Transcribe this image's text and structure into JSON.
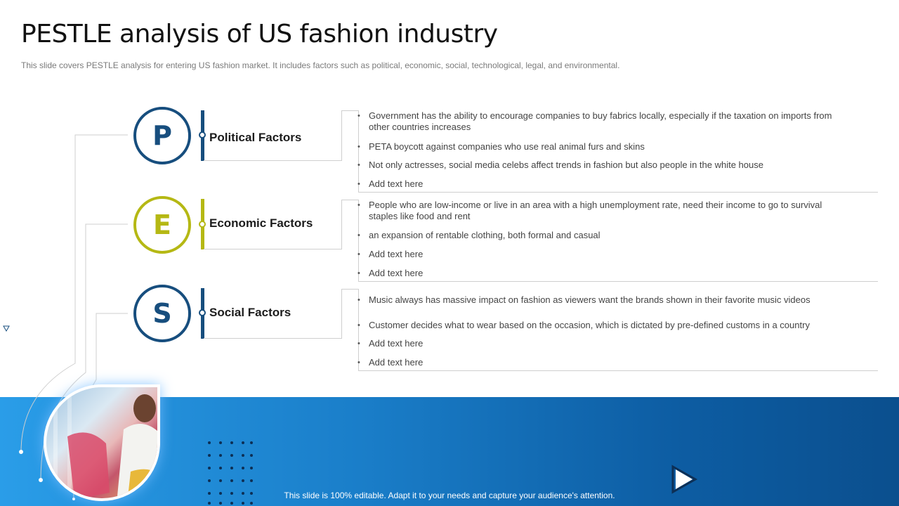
{
  "header": {
    "title": "PESTLE analysis of US fashion industry",
    "subtitle": "This slide covers PESTLE analysis for entering US fashion market. It includes factors such as political, economic, social, technological, legal, and environmental."
  },
  "factors": [
    {
      "letter": "P",
      "label": "Political Factors",
      "color": "#174e7e",
      "bullets": [
        "Government  has the ability to encourage  companies to buy fabrics locally, especially if the taxation on imports from other countries increases",
        "PETA boycott against companies who use real animal furs and skins",
        "Not only actresses, social media celebs affect trends in fashion  but also people in the white house",
        "Add text here"
      ]
    },
    {
      "letter": "E",
      "label": "Economic Factors",
      "color": "#b5b814",
      "bullets": [
        "People who are low-income  or live  in an area with a high unemployment  rate, need their income to go to survival  staples like food and rent",
        "an expansion of rentable clothing, both formal and casual",
        "Add text here",
        "Add text here"
      ]
    },
    {
      "letter": "S",
      "label": "Social Factors",
      "color": "#174e7e",
      "bullets": [
        "Music always has massive impact on fashion  as viewers  want the brands shown  in their favorite   music videos",
        "Customer decides  what to wear based on the occasion, which is dictated by pre-defined  customs in a country",
        "Add text here",
        "Add text here"
      ]
    }
  ],
  "footer": {
    "text": "This slide is 100% editable. Adapt it to your needs and capture your audience's attention."
  },
  "colors": {
    "banner_start": "#2a9de8",
    "banner_end": "#0b4f8e",
    "dark_blue": "#174e7e",
    "olive": "#b5b814"
  }
}
